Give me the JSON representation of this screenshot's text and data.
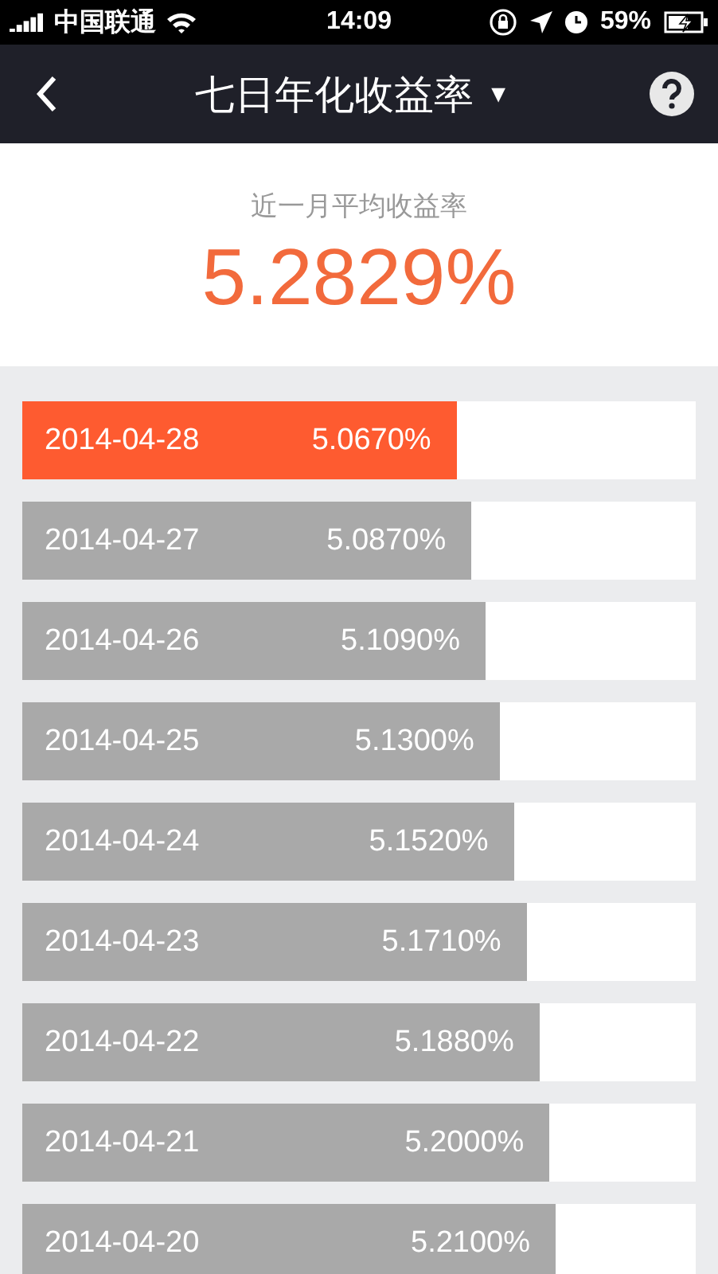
{
  "status_bar": {
    "carrier": "中国联通",
    "time": "14:09",
    "battery": "59%"
  },
  "header": {
    "title": "七日年化收益率",
    "dropdown": "▼"
  },
  "summary": {
    "label": "近一月平均收益率",
    "value": "5.2829%"
  },
  "rows": [
    {
      "date": "2014-04-28",
      "value": "5.0670%",
      "level": 0.645,
      "selected": true
    },
    {
      "date": "2014-04-27",
      "value": "5.0870%",
      "level": 0.667,
      "selected": false
    },
    {
      "date": "2014-04-26",
      "value": "5.1090%",
      "level": 0.688,
      "selected": false
    },
    {
      "date": "2014-04-25",
      "value": "5.1300%",
      "level": 0.709,
      "selected": false
    },
    {
      "date": "2014-04-24",
      "value": "5.1520%",
      "level": 0.73,
      "selected": false
    },
    {
      "date": "2014-04-23",
      "value": "5.1710%",
      "level": 0.749,
      "selected": false
    },
    {
      "date": "2014-04-22",
      "value": "5.1880%",
      "level": 0.768,
      "selected": false
    },
    {
      "date": "2014-04-21",
      "value": "5.2000%",
      "level": 0.783,
      "selected": false
    },
    {
      "date": "2014-04-20",
      "value": "5.2100%",
      "level": 0.792,
      "selected": false
    }
  ]
}
